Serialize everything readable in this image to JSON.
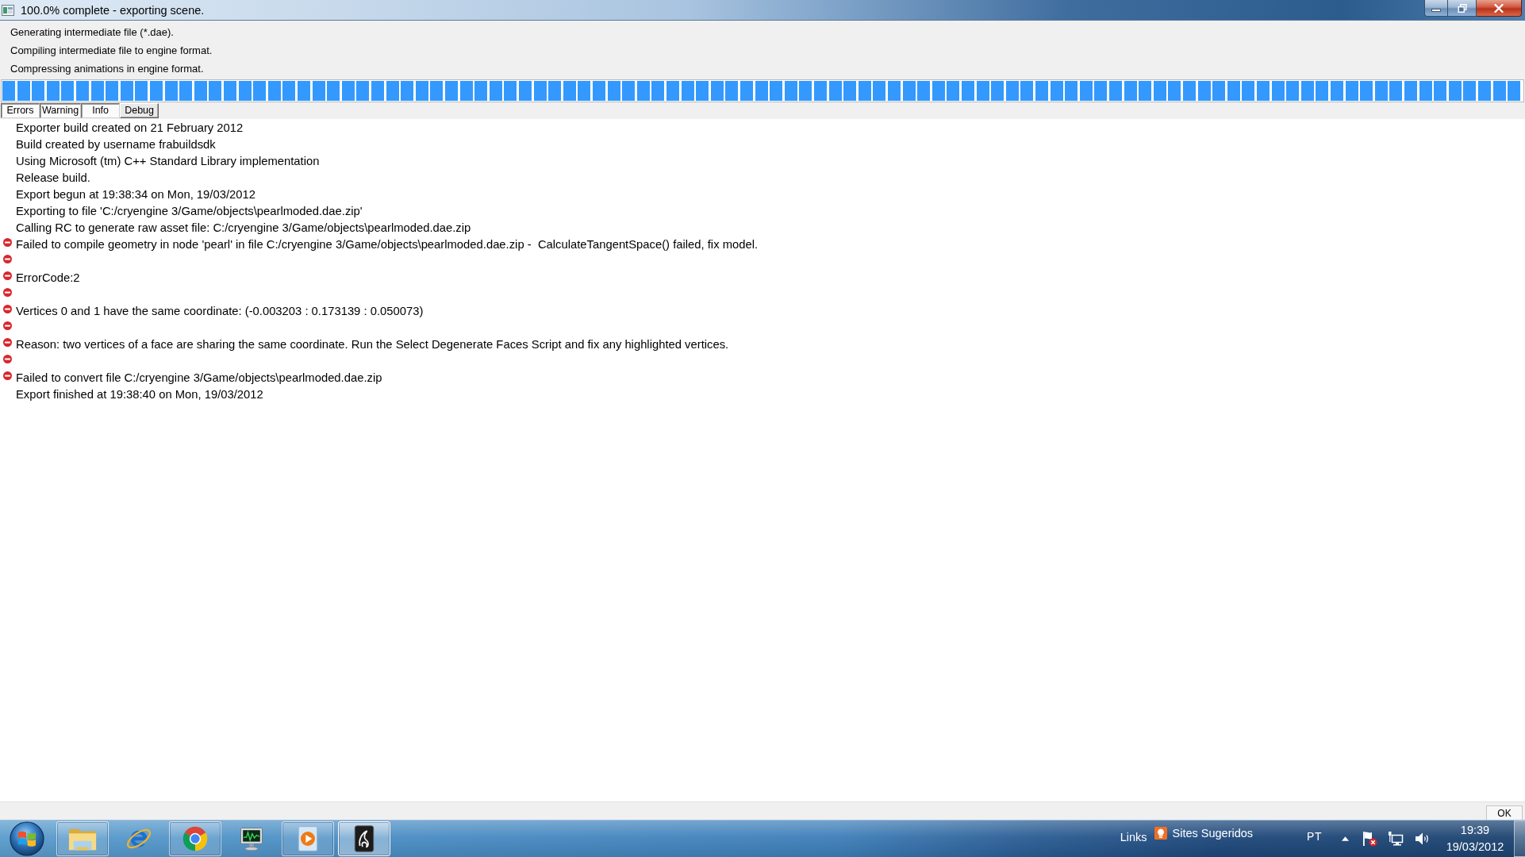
{
  "window": {
    "title": "100.0% complete - exporting scene."
  },
  "steps": [
    "Generating intermediate file (*.dae).",
    "Compiling intermediate file to engine format.",
    "Compressing animations in engine format."
  ],
  "progress": {
    "level": 1.0
  },
  "filters": [
    {
      "label": "Errors",
      "on": true
    },
    {
      "label": "Warning",
      "on": true
    },
    {
      "label": "Info",
      "on": true
    },
    {
      "label": "Debug",
      "on": false
    }
  ],
  "log": [
    {
      "kind": "info",
      "text": "Exporter build created on 21 February 2012"
    },
    {
      "kind": "info",
      "text": "Build created by username frabuildsdk"
    },
    {
      "kind": "info",
      "text": "Using Microsoft (tm) C++ Standard Library implementation"
    },
    {
      "kind": "info",
      "text": "Release build."
    },
    {
      "kind": "info",
      "text": "Export begun at 19:38:34 on Mon, 19/03/2012"
    },
    {
      "kind": "info",
      "text": "Exporting to file 'C:/cryengine 3/Game/objects\\pearlmoded.dae.zip'"
    },
    {
      "kind": "info",
      "text": "Calling RC to generate raw asset file: C:/cryengine 3/Game/objects\\pearlmoded.dae.zip"
    },
    {
      "kind": "error",
      "text": "Failed to compile geometry in node 'pearl' in file C:/cryengine 3/Game/objects\\pearlmoded.dae.zip -  CalculateTangentSpace() failed, fix model."
    },
    {
      "kind": "error"
    },
    {
      "kind": "error",
      "text": "ErrorCode:2"
    },
    {
      "kind": "error"
    },
    {
      "kind": "error",
      "text": "Vertices 0 and 1 have the same coordinate: (-0.003203 : 0.173139 : 0.050073)"
    },
    {
      "kind": "error"
    },
    {
      "kind": "error",
      "text": "Reason: two vertices of a face are sharing the same coordinate. Run the Select Degenerate Faces Script and fix any highlighted vertices."
    },
    {
      "kind": "error"
    },
    {
      "kind": "error",
      "text": "Failed to convert file C:/cryengine 3/Game/objects\\pearlmoded.dae.zip"
    },
    {
      "kind": "info",
      "text": "Export finished at 19:38:40 on Mon, 19/03/2012"
    }
  ],
  "dialog_buttons": [
    "OK"
  ],
  "taskbar": {
    "pinned": [
      {
        "kind": "folder",
        "running": true,
        "active": false
      },
      {
        "kind": "ie",
        "running": false,
        "active": false
      },
      {
        "kind": "chrome",
        "running": true,
        "active": false
      },
      {
        "kind": "monitor",
        "running": false,
        "active": false
      },
      {
        "kind": "player",
        "running": true,
        "active": false
      },
      {
        "kind": "app",
        "running": true,
        "active": true
      }
    ],
    "toolbar_label": "Links",
    "links": [
      {
        "label": "Sites Sugeridos"
      }
    ],
    "language": "PT",
    "clock": {
      "time": "19:39",
      "date": "19/03/2012"
    }
  }
}
